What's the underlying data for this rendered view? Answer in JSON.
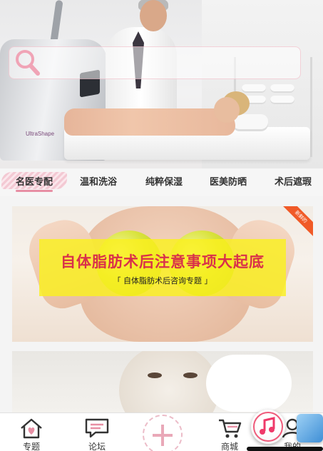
{
  "hero": {
    "brand_text": "UltraShape"
  },
  "search": {
    "value": "",
    "placeholder": ""
  },
  "tabs": [
    {
      "label": "名医专配",
      "active": true
    },
    {
      "label": "温和洗浴",
      "active": false
    },
    {
      "label": "纯粹保湿",
      "active": false
    },
    {
      "label": "医美防晒",
      "active": false
    },
    {
      "label": "术后遮瑕",
      "active": false
    }
  ],
  "cards": [
    {
      "title": "自体脂肪术后注意事项大起底",
      "subtitle": "「  自体脂肪术后咨询专题  」",
      "ribbon": "新鲜的"
    },
    {
      "title": "",
      "subtitle": ""
    }
  ],
  "bottom_nav": [
    {
      "label": "专题",
      "icon": "home-heart-icon"
    },
    {
      "label": "论坛",
      "icon": "chat-bubble-icon"
    },
    {
      "label": "",
      "icon": "plus-icon"
    },
    {
      "label": "商城",
      "icon": "cart-icon"
    },
    {
      "label": "我的",
      "icon": "user-icon"
    }
  ],
  "colors": {
    "accent_pink": "#e78fa4",
    "title_red": "#d9314a",
    "band_yellow": "#faf01e"
  }
}
